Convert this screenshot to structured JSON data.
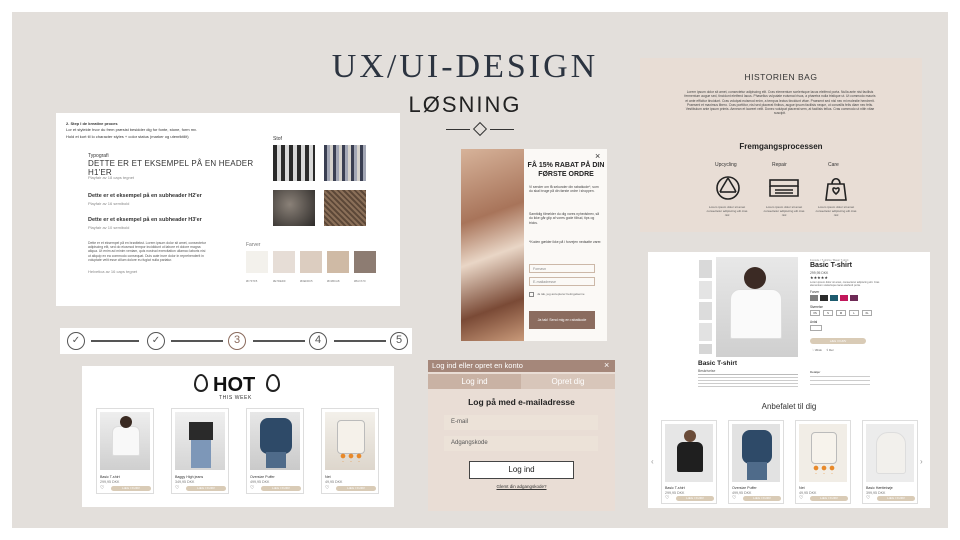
{
  "header": {
    "title": "UX/UI-DESIGN",
    "subtitle": "LØSNING"
  },
  "styleguide": {
    "intro_title": "2. Step I de kreative proces",
    "intro_line1": "Lor et styleide hvor du frem præsist besidder dig for fonte, stone, form mv.",
    "intro_line2": "Hold et kort til lo character styles + color status (marker og utenriktilit)",
    "typo_label": "Typografi",
    "h1_text": "DETTE ER ET EKSEMPEL PÅ EN HEADER H1'ER",
    "h1_meta": "Playfair av 18 caps tegnet",
    "h2_text": "Dette er et eksempel på en subheader H2'er",
    "h2_meta": "Playfair av 16 semibold",
    "h3_text": "Dette er et eksempel på en subheader H3'er",
    "h3_meta": "Playfair av 10 semibold",
    "body_text": "Dette er et eksempel på en brødtekst. Lorem ipsum dolor sit amet, consectetur adipiscing elit, sed do eiusmod tempor incididunt ut labore et dolore magna aliqua. Ut enim ad minim veniam, quis nostrud exercitation ullamco laboris nisi ut aliquip ex ea commodo consequat. Duis aute irure dolor in reprehenderit in voluptate velit esse cillum dolore eu fugiat nulla pariatur.",
    "body_meta": "Helvetica av 16 caps tegnet",
    "stof_label": "Stof",
    "farver_label": "Farver",
    "color_codes": [
      "#F7F7F5",
      "#E7DED9",
      "#DED0C5",
      "#D1BCA8",
      "#8A7A70"
    ],
    "colors": [
      "#f3f1ec",
      "#e6ddd6",
      "#dccdc0",
      "#cfbaa5",
      "#8d7c72"
    ]
  },
  "stepper": {
    "steps": [
      "✓",
      "✓",
      "3",
      "4",
      "5"
    ]
  },
  "hot": {
    "title": "HOT",
    "subtitle": "THIS WEEK",
    "products": [
      {
        "name": "Basic T-shirt",
        "price": "299,95 DKK",
        "button": "LÆG I KURV"
      },
      {
        "name": "Baggy High jeans",
        "price": "349,95 DKK",
        "button": "LÆG I KURV"
      },
      {
        "name": "Oversize Puffer",
        "price": "499,95 DKK",
        "button": "LÆG I KURV"
      },
      {
        "name": "Net",
        "price": "49,95 DKK",
        "button": "LÆG I KURV"
      }
    ]
  },
  "popup": {
    "close": "×",
    "heading": "FÅ 15% RABAT PÅ DIN FØRSTE ORDRE",
    "text1": "Vi sender om få sekunder din rabatkode*, som du skal bruge på din første ordre i shoppen.",
    "text2": "Samtidig tilmelder du dig vores nyhedsbrev, så du ikke går glip af vores gode tilbud, tips og tricks.",
    "text3": "*Koden gælder ikke på i forvejen nedsatte varer.",
    "field1": "Fornavn",
    "field2": "E-mailadresse",
    "consent": "Ja tak, jeg accepterer betingelserne",
    "button": "Ja tak! Send mig en rabatkode"
  },
  "login": {
    "bar_title": "Log ind eller opret en konto",
    "close": "×",
    "tab_login": "Log ind",
    "tab_register": "Opret dig",
    "heading": "Log på med e-mailadresse",
    "email_placeholder": "E-mail",
    "password_placeholder": "Adgangskode",
    "button": "Log ind",
    "forgot": "Glemt din adgangskode?"
  },
  "story": {
    "title": "HISTORIEN BAG",
    "body": "Lorem ipsum dolor sit amet, consectetur adipiscing elit. Cras elementum scelerisque lacus eleifend porta. Nulla ante nisi facilisis fermentum augue sed, tincidunt eleifend lacus. Phasellus vulputate euismod risus, a pharetra nulla tristique ut. Ut commodo mauris et ante efficitur tincidunt. Cras volutpat euismod enim, a tempus lectus tincidunt vitae. Praesent sed nisl nec mi molestie hendrerit. Praesent et maximus libero. Cras porttitor, nisl sed placerat finibus, augue ipsum facilisis neque, ut convallis felis diam nec felis. Vestibulum ante ipsum primis. Aenean et laoreet velit. Donec volutpat placerat sem, at facilisis tellus. Cras commodo ut nibh vitae suscipit.",
    "process_title": "Fremgangsprocessen",
    "steps": [
      {
        "label": "Upcycling",
        "text": "Lorem ipsum dolor sit amet consectetur adipiscing elit cras nisl"
      },
      {
        "label": "Repair",
        "text": "Lorem ipsum dolor sit amet consectetur adipiscing elit cras nisl"
      },
      {
        "label": "Care",
        "text": "Lorem ipsum dolor sit amet consectetur adipiscing elit cras nisl"
      }
    ]
  },
  "product_page": {
    "breadcrumb": "Forside / T-shirts / Basic T-shirt",
    "name": "Basic T-shirt",
    "price": "299,95 DKK",
    "stars": "★★★★★",
    "description_short": "Lorem ipsum dolor sit amet, consectetur adipiscing elit. Cras elementum scelerisque lacus eleifend porta.",
    "color_label": "Farver",
    "size_label": "Størrelse",
    "sizes": [
      "XS",
      "S",
      "M",
      "L",
      "XL"
    ],
    "qty_label": "Antal",
    "add_button": "LÆG I KURV",
    "wishlist": "Ønsk",
    "share": "Del",
    "title_under": "Basic T-shirt",
    "desc_label": "Beskrivelse",
    "details_label": "Detaljer",
    "recommended_title": "Anbefalet til dig",
    "swatches": [
      "#7d7d7d",
      "#2b2b2b",
      "#1d5b6e",
      "#c2185b",
      "#6e2a56"
    ],
    "recommended": [
      {
        "name": "Basic T-shirt",
        "price": "299,95 DKK",
        "button": "LÆG I KURV"
      },
      {
        "name": "Oversize Puffer",
        "price": "499,95 DKK",
        "button": "LÆG I KURV"
      },
      {
        "name": "Net",
        "price": "49,95 DKK",
        "button": "LÆG I KURV"
      },
      {
        "name": "Basic Hættetrøje",
        "price": "399,95 DKK",
        "button": "LÆG I KURV"
      }
    ]
  }
}
